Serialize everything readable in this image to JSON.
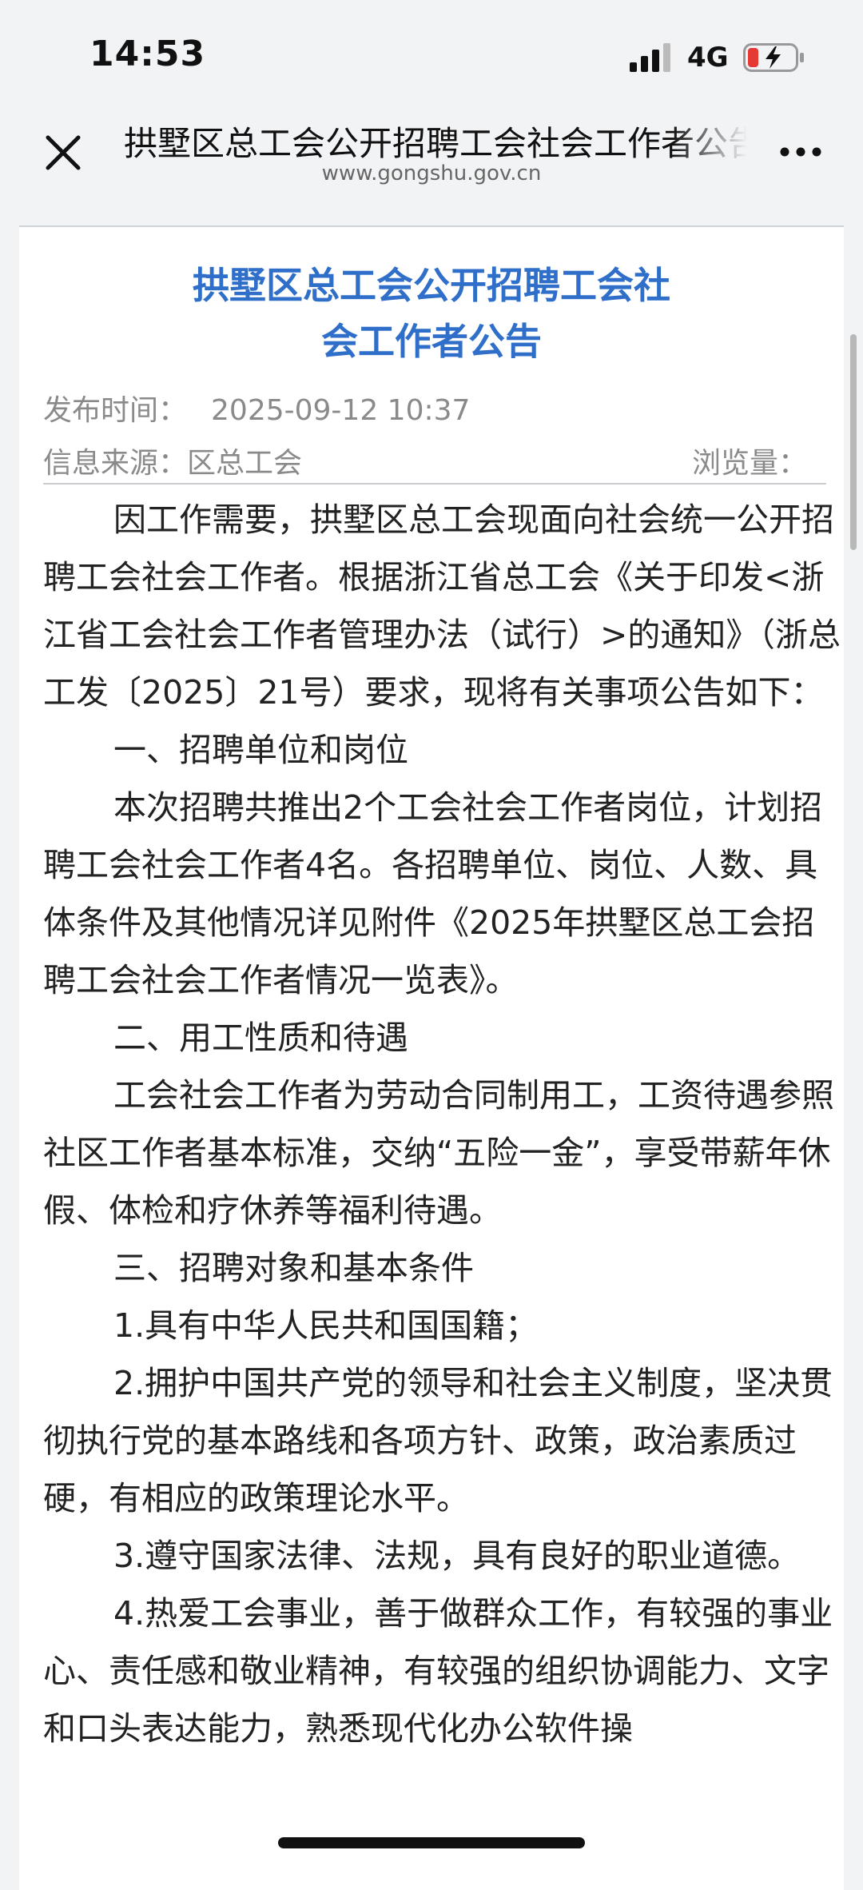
{
  "status_bar": {
    "time": "14:53",
    "network": "4G",
    "icons": [
      "signal-icon",
      "battery-charging-icon"
    ],
    "battery_color": "#e53935"
  },
  "nav": {
    "title": "拱墅区总工会公开招聘工会社会工作者公告",
    "url": "www.gongshu.gov.cn",
    "close_icon": "close-icon",
    "more_icon": "more-icon"
  },
  "article": {
    "title_line1": "拱墅区总工会公开招聘工会社",
    "title_line2": "会工作者公告",
    "title_color": "#2f6fc9",
    "publish_label": "发布时间：",
    "publish_time": "2025-09-12 10:37",
    "source_label": "信息来源：",
    "source_value": "区总工会",
    "views_label": "浏览量：",
    "paragraphs": [
      "因工作需要，拱墅区总工会现面向社会统一公开招聘工会社会工作者。根据浙江省总工会《关于印发<浙江省工会社会工作者管理办法（试行）>的通知》（浙总工发〔2025〕21号）要求，现将有关事项公告如下：",
      "一、招聘单位和岗位",
      "本次招聘共推出2个工会社会工作者岗位，计划招聘工会社会工作者4名。各招聘单位、岗位、人数、具体条件及其他情况详见附件《2025年拱墅区总工会招聘工会社会工作者情况一览表》。",
      "二、用工性质和待遇",
      "工会社会工作者为劳动合同制用工，工资待遇参照社区工作者基本标准，交纳“五险一金”，享受带薪年休假、体检和疗休养等福利待遇。",
      "三、招聘对象和基本条件",
      "1.具有中华人民共和国国籍；",
      "2.拥护中国共产党的领导和社会主义制度，坚决贯彻执行党的基本路线和各项方针、政策，政治素质过硬，有相应的政策理论水平。",
      "3.遵守国家法律、法规，具有良好的职业道德。",
      "4.热爱工会事业，善于做群众工作，有较强的事业心、责任感和敬业精神，有较强的组织协调能力、文字和口头表达能力，熟悉现代化办公软件操"
    ]
  }
}
